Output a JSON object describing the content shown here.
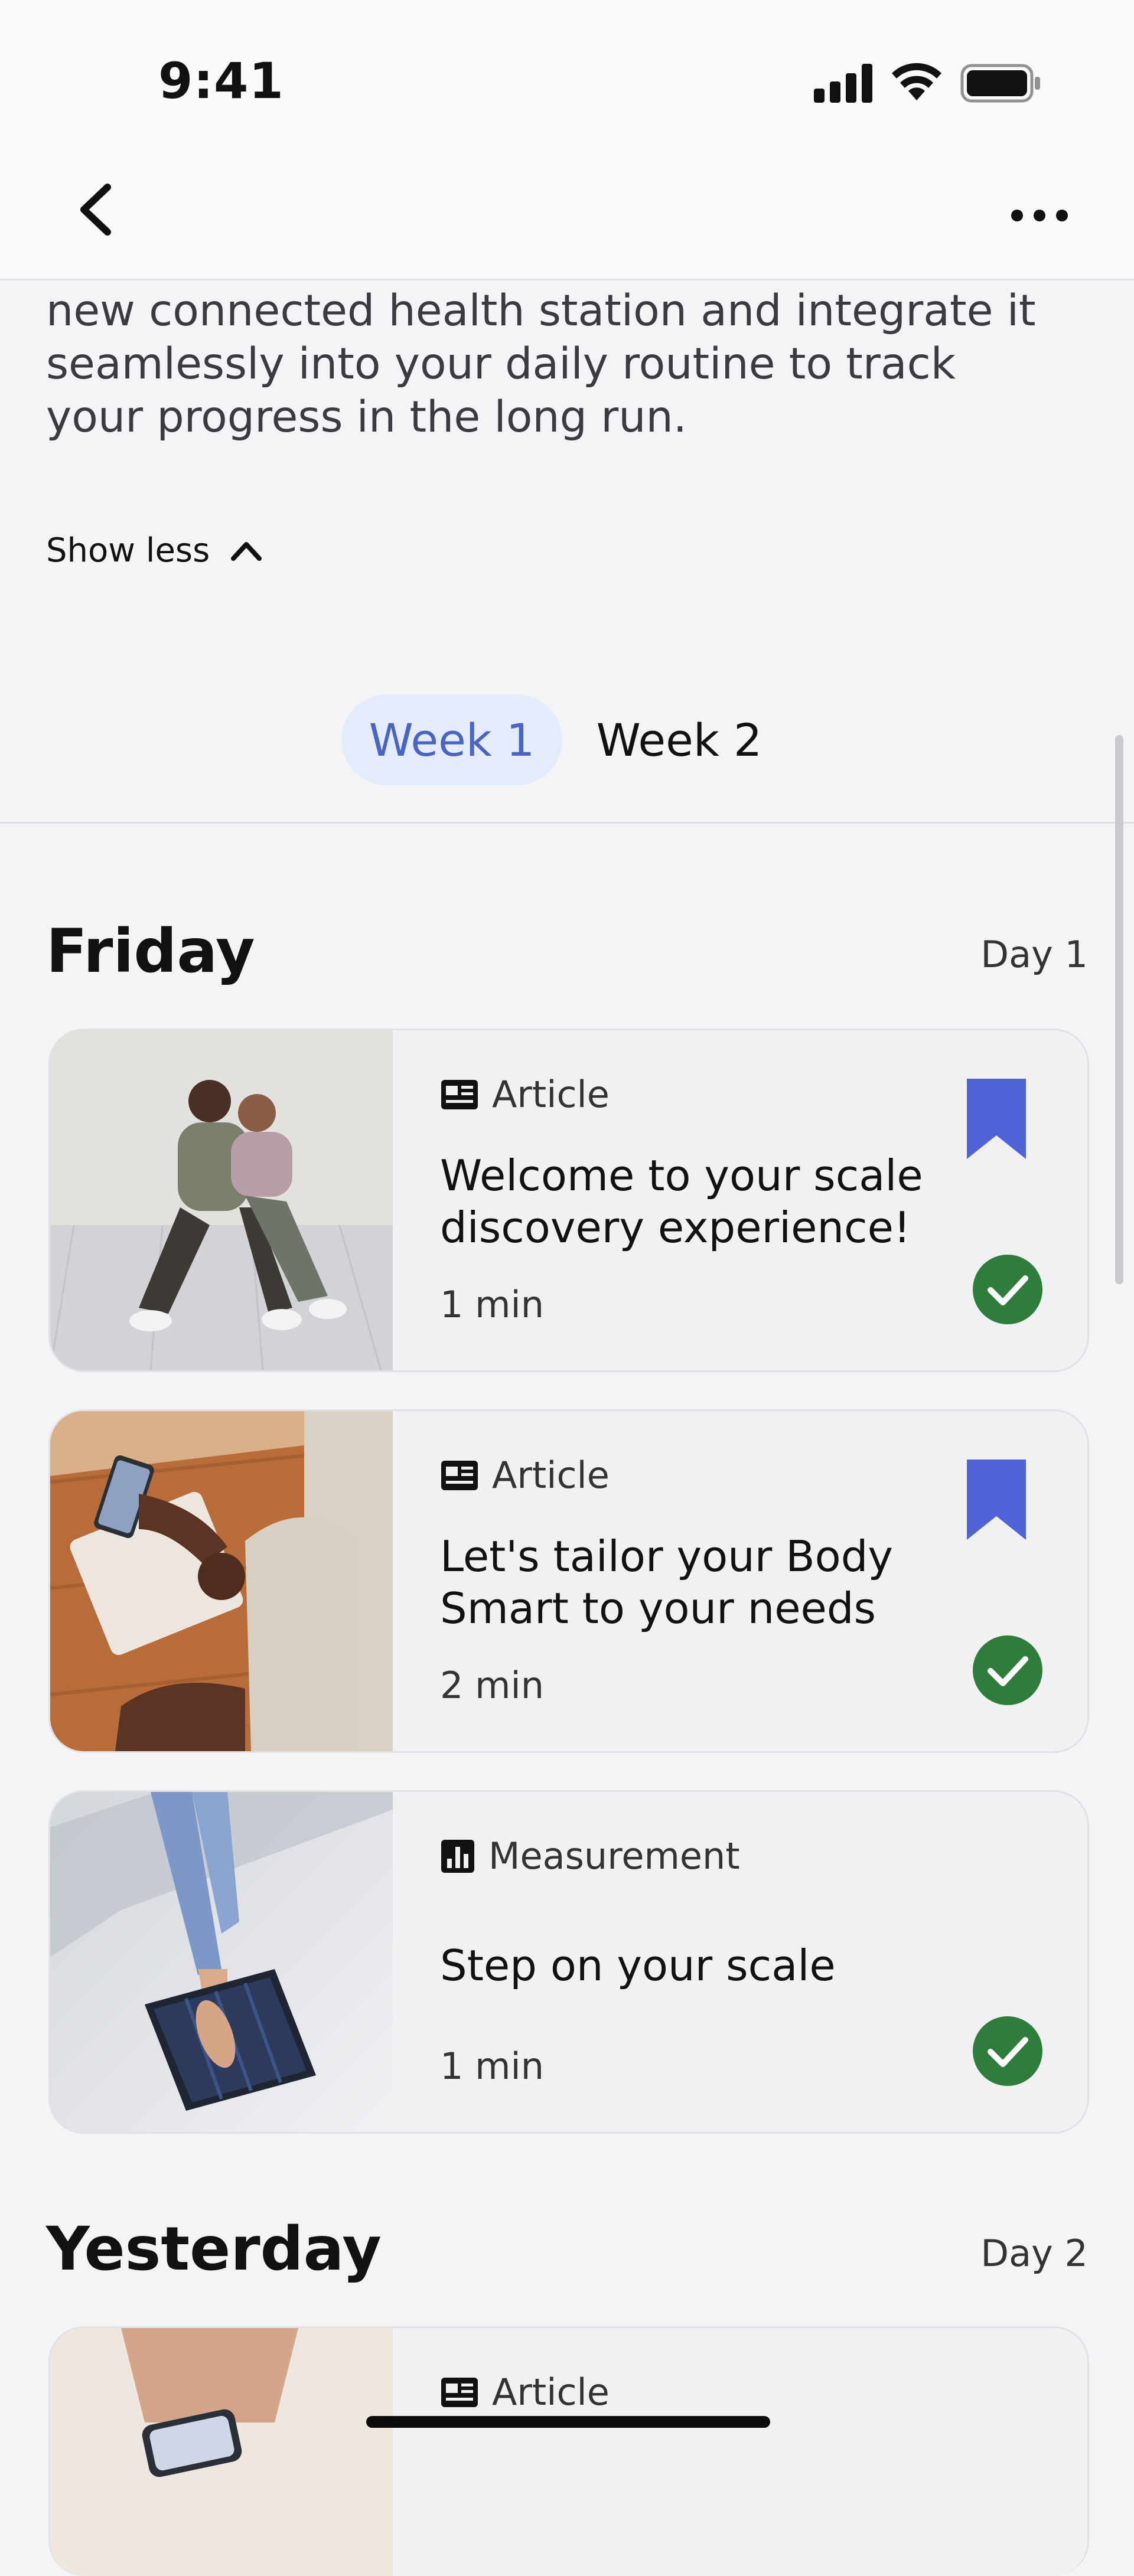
{
  "status_bar": {
    "time": "9:41"
  },
  "description": {
    "text": "new connected health station and integrate it seamlessly into your daily routine to track your progress in the long run."
  },
  "show_less_label": "Show less",
  "tabs": [
    {
      "label": "Week 1",
      "selected": true
    },
    {
      "label": "Week 2",
      "selected": false
    }
  ],
  "sections": [
    {
      "heading": "Friday",
      "day": "Day 1",
      "cards": [
        {
          "type": "Article",
          "type_icon": "article-icon",
          "title": "Welcome to your scale discovery experience!",
          "duration": "1 min",
          "bookmarked": true,
          "completed": true
        },
        {
          "type": "Article",
          "type_icon": "article-icon",
          "title": "Let's tailor your Body Smart to your needs",
          "duration": "2 min",
          "bookmarked": true,
          "completed": true
        },
        {
          "type": "Measurement",
          "type_icon": "bar-chart-icon",
          "title": "Step on your scale",
          "duration": "1 min",
          "bookmarked": false,
          "completed": true
        }
      ]
    },
    {
      "heading": "Yesterday",
      "day": "Day 2",
      "cards": [
        {
          "type": "Article",
          "type_icon": "article-icon"
        }
      ]
    }
  ],
  "colors": {
    "accent": "#4a64c4",
    "tab_selected_bg": "#e4ebfa",
    "bookmark": "#4d63d6",
    "complete": "#2f7d3c",
    "background": "#f4f4f6"
  }
}
